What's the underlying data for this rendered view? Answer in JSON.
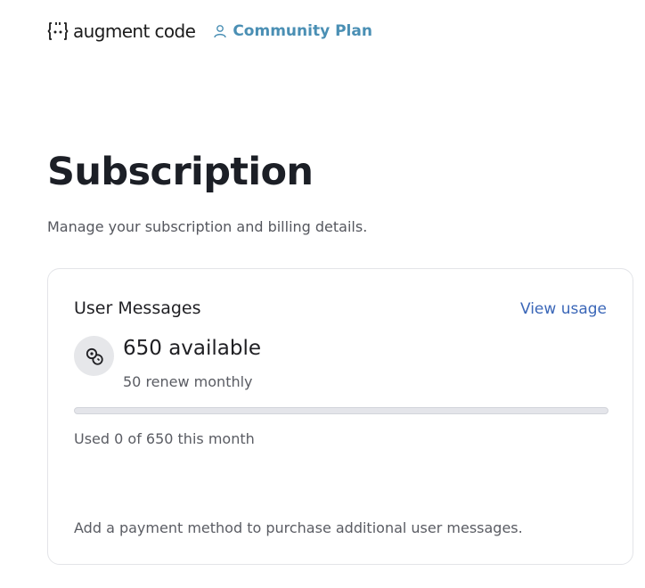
{
  "header": {
    "logo_text": "augment code",
    "plan_label": "Community Plan"
  },
  "page": {
    "title": "Subscription",
    "subtitle": "Manage your subscription and billing details."
  },
  "usage_card": {
    "title": "User Messages",
    "view_usage_label": "View usage",
    "available": "650 available",
    "renew": "50 renew monthly",
    "progress_used": 0,
    "progress_total": 650,
    "used_text": "Used 0 of 650 this month",
    "payment_note": "Add a payment method to purchase additional user messages."
  },
  "colors": {
    "accent_plan": "#4a8fb4",
    "link": "#3b67b8",
    "progress_track": "#e4e5ea"
  },
  "icons": {
    "logo": "augment-logo-icon",
    "plan": "user-icon",
    "credits": "coins-icon"
  }
}
